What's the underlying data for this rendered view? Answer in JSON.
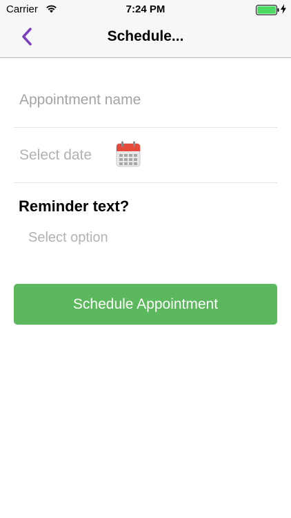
{
  "status_bar": {
    "carrier": "Carrier",
    "time": "7:24 PM",
    "wifi_icon": "wifi-icon",
    "battery_icon": "battery-icon",
    "charging_icon": "charging-bolt-icon",
    "battery_color": "#4cd964"
  },
  "nav": {
    "back_icon": "chevron-left-icon",
    "title": "Schedule...",
    "accent_color": "#7b3fbf"
  },
  "form": {
    "appointment_name_placeholder": "Appointment name",
    "select_date_label": "Select date",
    "calendar_icon": "calendar-icon",
    "reminder_heading": "Reminder text?",
    "select_option_label": "Select option",
    "submit_label": "Schedule Appointment",
    "submit_color": "#5cb85c"
  }
}
